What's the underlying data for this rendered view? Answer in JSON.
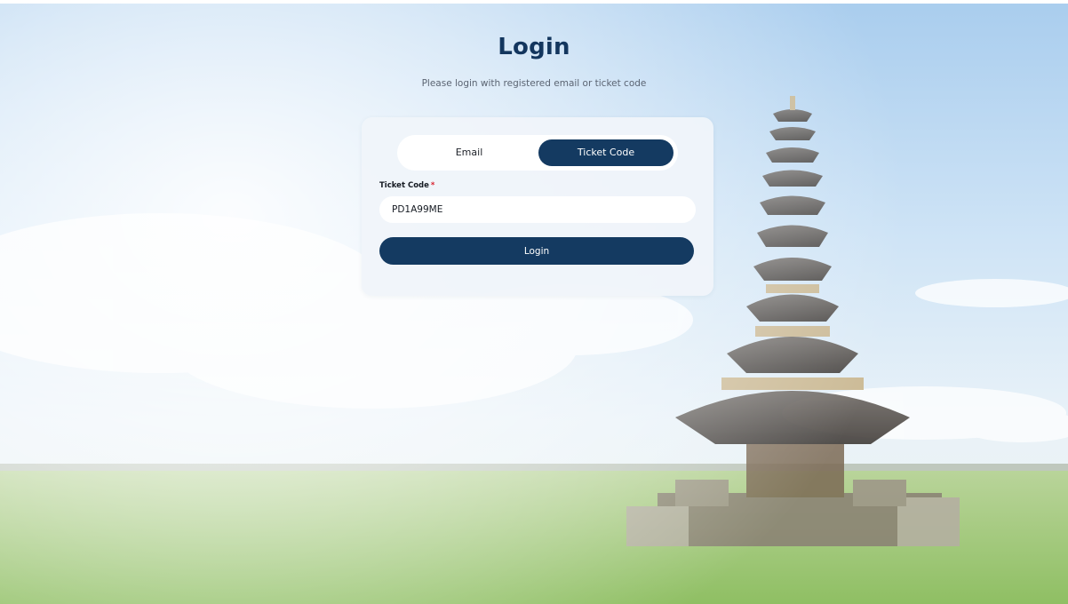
{
  "page": {
    "title": "Login",
    "subtitle": "Please login with registered email or ticket code"
  },
  "login_mode": {
    "options": [
      "Email",
      "Ticket Code"
    ],
    "selected": "Ticket Code"
  },
  "form": {
    "field_label": "Ticket Code",
    "required_marker": "*",
    "ticket_value": "PD1A99ME",
    "submit_label": "Login"
  },
  "colors": {
    "primary": "#143a61",
    "title": "#13365e",
    "required": "#d8202d",
    "card_background": "#f0f4fa"
  },
  "background": {
    "scene": "bali-temple-pagoda-over-rice-field"
  }
}
